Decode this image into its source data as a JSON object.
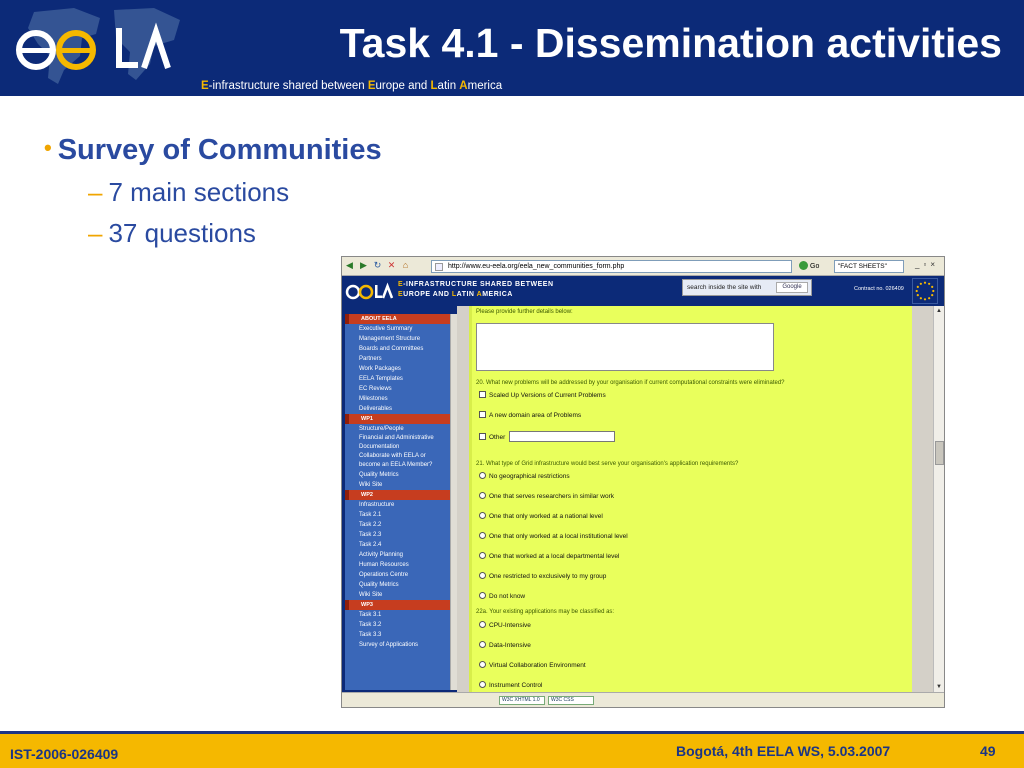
{
  "header": {
    "title": "Task 4.1 - Dissemination activities",
    "subtitle_parts": [
      "E",
      "-infrastructure shared between ",
      "E",
      "urope and ",
      "L",
      "atin ",
      "A",
      "merica"
    ]
  },
  "bullets": {
    "main": "Survey of Communities",
    "sub": [
      "7 main sections",
      "37 questions"
    ]
  },
  "browser": {
    "url": "http://www.eu-eela.org/eela_new_communities_form.php",
    "go_label": "Go",
    "search_value": "\"FACT SHEETS\"",
    "site": {
      "tagline_parts": [
        "E",
        "-INFRASTRUCTURE SHARED BETWEEN",
        "E",
        "UROPE AND ",
        "L",
        "ATIN ",
        "A",
        "MERICA"
      ],
      "search_placeholder": "search inside the site with",
      "search_button": "Google",
      "contract": "Contract no. 026409"
    },
    "sidebar": {
      "sections": [
        {
          "label": "ABOUT EELA",
          "items": [
            "Executive Summary",
            "Management Structure",
            "Boards and Committees",
            "Partners",
            "Work Packages",
            "EELA Templates",
            "EC Reviews",
            "Milestones",
            "Deliverables"
          ]
        },
        {
          "label": "WP1",
          "items": [
            "Structure/People",
            "Financial and Administrative Documentation",
            "Collaborate with EELA or become an EELA Member?",
            "Quality Metrics",
            "Wiki Site"
          ]
        },
        {
          "label": "WP2",
          "items": [
            "Infrastructure",
            "Task 2.1",
            "Task 2.2",
            "Task 2.3",
            "Task 2.4",
            "Activity Planning",
            "Human Resources",
            "Operations Centre",
            "Quality Metrics",
            "Wiki Site"
          ]
        },
        {
          "label": "WP3",
          "items": [
            "Task 3.1",
            "Task 3.2",
            "Task 3.3",
            "Survey of Applications"
          ]
        }
      ]
    },
    "form": {
      "details_prompt": "Please provide further details below:",
      "q20": "20. What new problems will be addressed by your organisation if current computational constraints were eliminated?",
      "q20_options": [
        "Scaled Up Versions of Current Problems",
        "A new domain area of Problems",
        "Other"
      ],
      "q21": "21. What type of Grid infrastructure would best serve your organisation's application requirements?",
      "q21_options": [
        "No geographical restrictions",
        "One that serves researchers in similar work",
        "One that only worked at a national level",
        "One that only worked at a local institutional level",
        "One that worked at a local departmental level",
        "One restricted to exclusively to my group",
        "Do not know"
      ],
      "q22a": "22a. Your existing applications may be classified as:",
      "q22a_options": [
        "CPU-Intensive",
        "Data-Intensive",
        "Virtual Collaboration Environment",
        "Instrument Control"
      ]
    },
    "status_badges": [
      "W3C XHTML 1.0",
      "W3C CSS"
    ]
  },
  "footer": {
    "left": "IST-2006-026409",
    "right": "Bogotá, 4th EELA WS, 5.03.2007",
    "page": "49"
  },
  "colors": {
    "brand_blue": "#0c2a78",
    "accent_orange": "#f5b800",
    "bullet_blue": "#2a4aa0",
    "form_bg": "#e9ff5c",
    "sidebar_section": "#c63d1f"
  }
}
